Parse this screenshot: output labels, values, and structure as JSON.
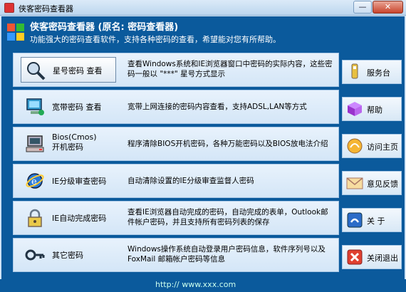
{
  "window": {
    "title": "侠客密码查看器",
    "minimize": "—",
    "close": "✕"
  },
  "header": {
    "title": "侠客密码查看器 (原名: 密码查看器)",
    "subtitle": "功能强大的密码查看软件，支持各种密码的查看，希望能对您有所帮助。"
  },
  "rows": [
    {
      "label": "星号密码 查看",
      "desc": "查看Windows系统和IE浏览器窗口中密码的实际内容，这些密码一般以 \"***\" 星号方式显示"
    },
    {
      "label": "宽带密码 查看",
      "desc": "宽带上网连接的密码内容查看，支持ADSL,LAN等方式"
    },
    {
      "label": "Bios(Cmos)",
      "label2": "开机密码",
      "desc": "程序清除BIOS开机密码，各种万能密码以及BIOS放电法介绍"
    },
    {
      "label": "IE分级审查密码",
      "desc": "自动清除设置的IE分级审查监督人密码"
    },
    {
      "label": "IE自动完成密码",
      "desc": "查看IE浏览器自动完成的密码，自动完成的表单，Outlook邮件帐户密码，并且支持所有密码列表的保存"
    },
    {
      "label": "其它密码",
      "desc": "Windows操作系统自动登录用户密码信息，软件序列号以及FoxMail 邮箱帐户密码等信息"
    }
  ],
  "side": [
    {
      "label": "服务台"
    },
    {
      "label": "帮助"
    },
    {
      "label": "访问主页"
    },
    {
      "label": "意见反馈"
    },
    {
      "label": "关 于"
    },
    {
      "label": "关闭退出"
    }
  ],
  "footer": {
    "url": "http:// www.xxx.com"
  }
}
